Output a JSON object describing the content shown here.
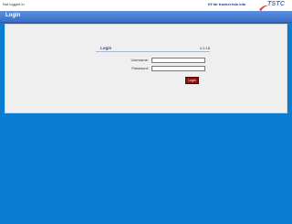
{
  "topbar": {
    "status_text": "Not logged in",
    "tracker_link": "Kf tbr tracker.tstc.edu",
    "logo_text": "TSTC",
    "logo_color": "#3a6fd0"
  },
  "header": {
    "title": "Login",
    "bg_color": "#4a80d6"
  },
  "login": {
    "title": "Login",
    "version": "4.2.18",
    "username_label": "Username:",
    "username_value": "",
    "password_label": "Password:",
    "password_value": "",
    "submit_label": "Login",
    "submit_color": "#8a1212"
  },
  "page": {
    "bg_color": "#0a7dd3"
  }
}
